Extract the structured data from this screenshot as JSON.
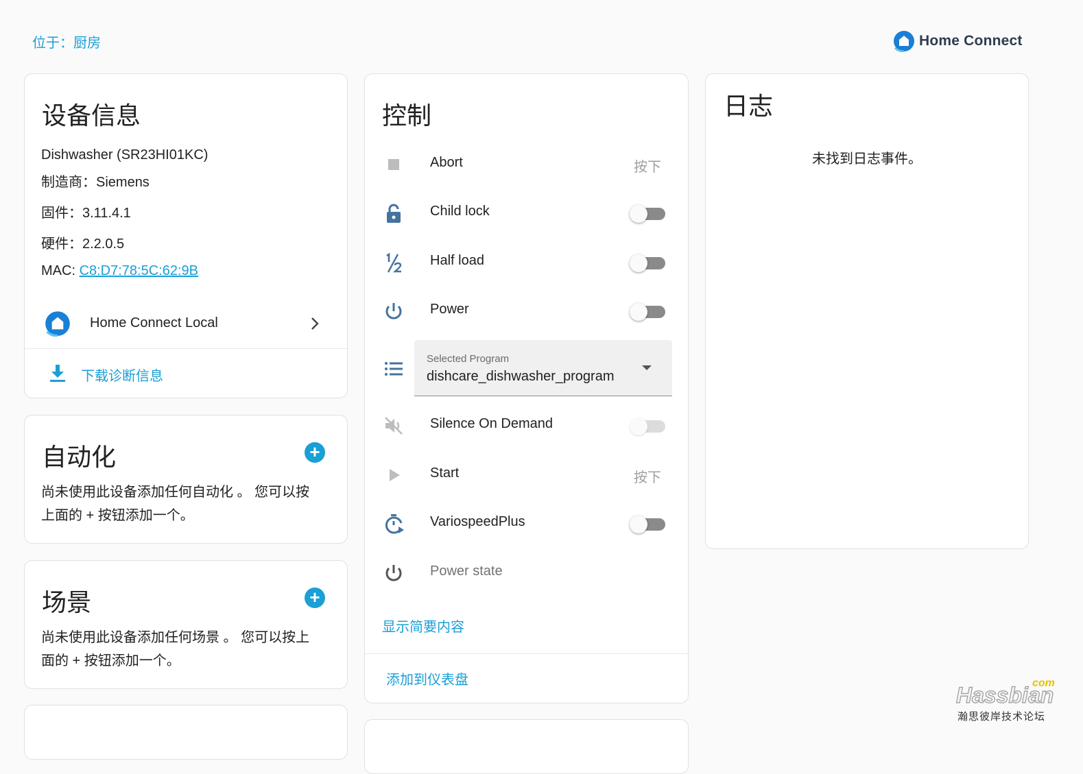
{
  "breadcrumb": {
    "area_label": "位于：厨房"
  },
  "brand": {
    "name": "Home Connect",
    "accent": "#1a7fd6"
  },
  "device_info": {
    "title": "设备信息",
    "model": "Dishwasher (SR23HI01KC)",
    "manufacturer": "制造商：Siemens",
    "firmware": "固件：3.11.4.1",
    "hardware": "硬件：2.2.0.5",
    "mac_label": "MAC: ",
    "mac_value": "C8:D7:78:5C:62:9B",
    "integration_name": "Home Connect Local",
    "download_label": "下载诊断信息"
  },
  "automation": {
    "title": "自动化",
    "empty_text_line1": "尚未使用此设备添加任何自动化 。 您可以按",
    "empty_text_line2": "上面的 + 按钮添加一个。"
  },
  "scenes": {
    "title": "场景",
    "empty_text_line1": "尚未使用此设备添加任何场景 。 您可以按上",
    "empty_text_line2": "面的 + 按钮添加一个。"
  },
  "controls": {
    "title": "控制",
    "press_label": "按下",
    "items": [
      {
        "label": "Abort",
        "icon": "stop-icon",
        "type": "button"
      },
      {
        "label": "Child lock",
        "icon": "lock-icon",
        "type": "switch",
        "on": false
      },
      {
        "label": "Half load",
        "icon": "half-fraction-icon",
        "type": "switch",
        "on": false
      },
      {
        "label": "Power",
        "icon": "power-icon",
        "type": "switch",
        "on": false
      },
      {
        "label": "Silence On Demand",
        "icon": "volume-off-icon",
        "type": "switch",
        "on": false,
        "disabled": true
      },
      {
        "label": "Start",
        "icon": "play-icon",
        "type": "button"
      },
      {
        "label": "VariospeedPlus",
        "icon": "timer-play-icon",
        "type": "switch",
        "on": false
      },
      {
        "label": "Power state",
        "icon": "power-icon",
        "type": "state"
      }
    ],
    "selected_program": {
      "label": "Selected Program",
      "value": "dishcare_dishwasher_program"
    },
    "show_summary_label": "显示简要内容",
    "add_to_dashboard_label": "添加到仪表盘"
  },
  "logbook": {
    "title": "日志",
    "empty_text": "未找到日志事件。"
  },
  "watermark": {
    "brand": "Hassbian",
    "suffix": "com",
    "tagline": "瀚思彼岸技术论坛"
  },
  "colors": {
    "link": "#1a9fd6",
    "icon_blue": "#44739e",
    "toggle_off_track": "#8a8a8a"
  }
}
